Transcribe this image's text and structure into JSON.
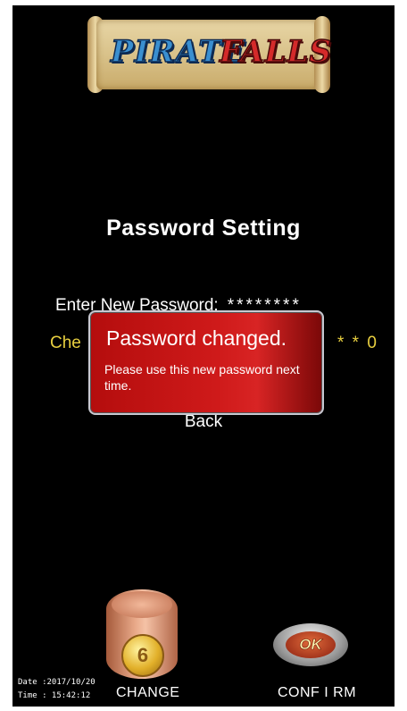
{
  "logo": {
    "word1": "PIRATE",
    "word2": "FALLS"
  },
  "page": {
    "title": "Password Setting"
  },
  "fields": {
    "new_password_label": "Enter New Password:",
    "new_password_value": "********",
    "check_password_label": "Che",
    "check_password_value": "* * 0"
  },
  "dialog": {
    "heading": "Password changed.",
    "body": "Please use this new password next time."
  },
  "nav": {
    "back_label": "Back"
  },
  "controls": {
    "change_label": "CHANGE",
    "confirm_label": "CONF I RM",
    "ok_text": "OK",
    "coin_symbol": "6"
  },
  "status": {
    "date_text": "Date :2017/10/20",
    "time_text": "Time :  15:42:12"
  },
  "colors": {
    "background": "#000000",
    "highlight": "#e9d040",
    "dialog": "#cf1a1a"
  },
  "icons": {
    "change": "coin-barrel-icon",
    "confirm": "ok-button-icon"
  }
}
